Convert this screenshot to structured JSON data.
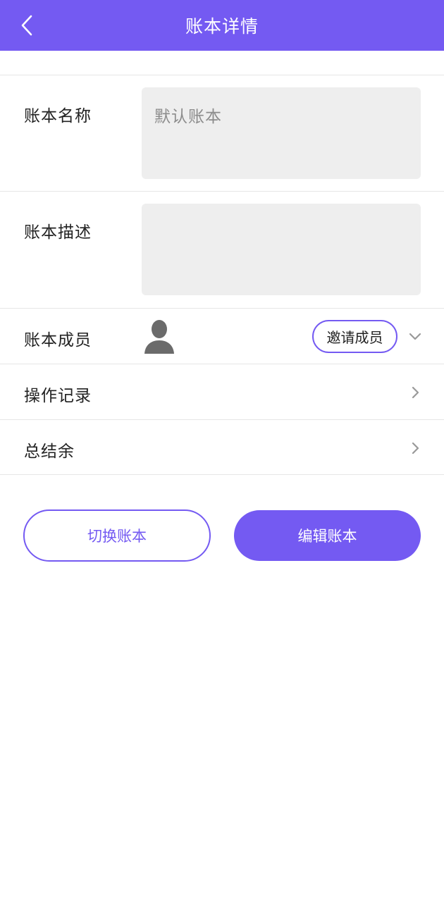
{
  "header": {
    "title": "账本详情",
    "back_icon": "chevron-left-icon",
    "background_color": "#745af2"
  },
  "ledger_name": {
    "label": "账本名称",
    "value": "",
    "placeholder": "默认账本"
  },
  "ledger_description": {
    "label": "账本描述",
    "value": "",
    "placeholder": ""
  },
  "ledger_members": {
    "label": "账本成员",
    "avatar_icon": "user-avatar-icon",
    "invite_label": "邀请成员",
    "expand_icon": "chevron-down-icon"
  },
  "operation_log": {
    "label": "操作记录",
    "icon": "chevron-right-icon"
  },
  "total_balance": {
    "label": "总结余",
    "icon": "chevron-right-icon"
  },
  "actions": {
    "switch_label": "切换账本",
    "edit_label": "编辑账本"
  },
  "colors": {
    "accent": "#745af2",
    "field_bg": "#eeeeee",
    "divider": "#e6e6e6"
  }
}
